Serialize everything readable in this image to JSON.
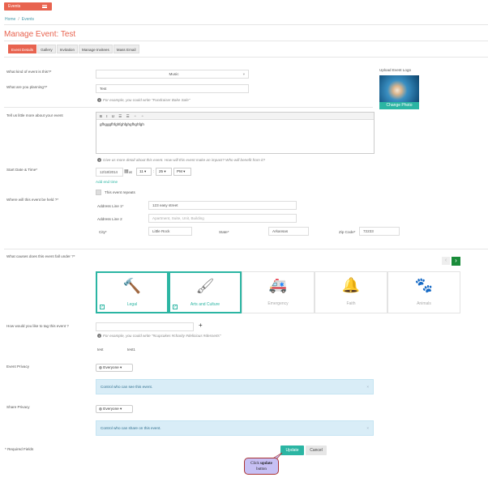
{
  "header": {
    "menu_label": "Events"
  },
  "breadcrumb": {
    "home": "Home",
    "sep": "/",
    "current": "Events"
  },
  "page_title": "Manage Event: Test",
  "tabs": [
    "Event Details",
    "Gallery",
    "Invitation",
    "Manage Invitees",
    "Mass Email"
  ],
  "form": {
    "kind_label": "What kind of event is this?*",
    "kind_value": "Music",
    "planning_label": "What are you planning?*",
    "planning_value": "Test",
    "planning_help": "For example, you could write \"Fundraiser Bake Sale\"",
    "logo_label": "Upload Event Logo",
    "logo_button": "Change Photo",
    "about_label": "Tell us little more about your event",
    "about_toolbar": "B I U",
    "about_value": "gfhgggfhfghfghfghgfhghfgh",
    "about_help": "Give us more detail about this event. How will this event make an impact? Who will benefit from it?",
    "start_label": "Start Date & Time*",
    "date_value": "12/18/2014",
    "at": "at",
    "hour": "11",
    "minute": "25",
    "ampm": "PM",
    "add_end": "Add end time",
    "repeats": "This event repeats",
    "where_label": "Where will this event be held ?*",
    "addr1_label": "Address Line 1*",
    "addr1_value": "123 easy street",
    "addr2_label": "Address Line 2",
    "addr2_placeholder": "Apartment, Suite, Unit, Building",
    "city_label": "City*",
    "city_value": "Little Rock",
    "state_label": "State*",
    "state_value": "Arkansas",
    "zip_label": "Zip Code*",
    "zip_value": "72233",
    "causes_label": "What causes does this event fall under ?*",
    "causes": [
      {
        "name": "Legal",
        "icon": "gavel-icon",
        "on": true
      },
      {
        "name": "Arts and Culture",
        "icon": "brush-icon",
        "on": true
      },
      {
        "name": "Emergency",
        "icon": "ambulance-icon",
        "on": false
      },
      {
        "name": "Faith",
        "icon": "bell-icon",
        "on": false
      },
      {
        "name": "Animals",
        "icon": "paw-icon",
        "on": false
      }
    ],
    "tag_label": "How would you like to tag this event ?",
    "tag_plus": "+",
    "tag_help": "For example, you could write \"#cupcakes #charity #delicious #desserts\"",
    "tags": [
      "test",
      "test1"
    ],
    "privacy_label": "Event Privacy",
    "privacy_value": "Everyone",
    "privacy_alert": "Control who can see this event.",
    "share_label": "Share Privacy",
    "share_value": "Everyone",
    "share_alert": "Control who can share on this event.",
    "alert_close": "×",
    "required": "* Required Fields",
    "update": "Update",
    "cancel": "Cancel"
  },
  "callout": {
    "line1": "Click ",
    "bold": "update",
    "line2": "button"
  },
  "colors": {
    "accent": "#e8634f",
    "teal": "#2bb5a3"
  }
}
